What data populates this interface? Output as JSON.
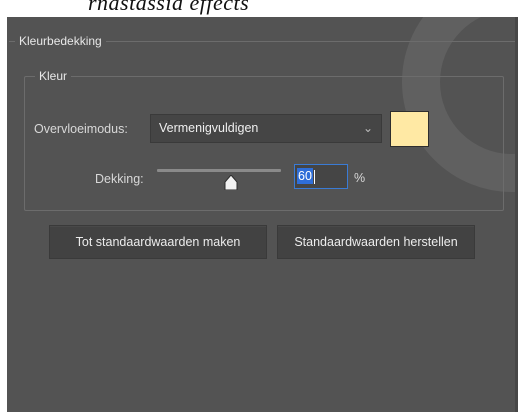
{
  "top_strip_text": "rnastassia effects",
  "section": {
    "title": "Kleurbedekking",
    "group_title": "Kleur"
  },
  "blend": {
    "label": "Overvloeimodus:",
    "value": "Vermenigvuldigen",
    "chevron_icon": "chevron-down-icon"
  },
  "swatch_color": "#ffe9a4",
  "opacity": {
    "label": "Dekking:",
    "value": "60",
    "unit": "%",
    "slider_percent": 60
  },
  "buttons": {
    "make_default": "Tot standaardwaarden maken",
    "reset_default": "Standaardwaarden herstellen"
  },
  "colors": {
    "panel_bg": "#535353",
    "input_bg": "#454545",
    "focus_blue": "#3a7bd5"
  }
}
